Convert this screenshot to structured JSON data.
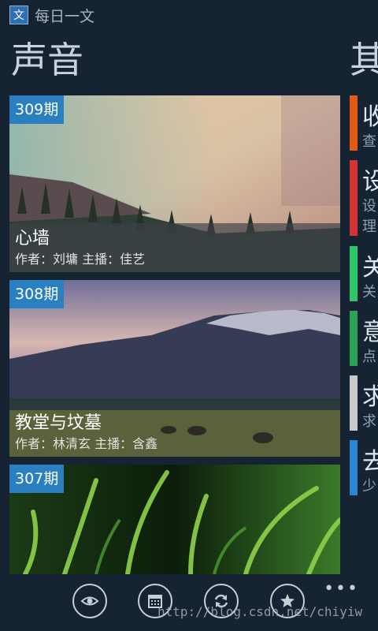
{
  "app": {
    "icon_glyph": "文",
    "title": "每日一文"
  },
  "sections": {
    "left_title": "声音",
    "right_title": "其"
  },
  "cards": [
    {
      "badge": "309期",
      "title": "心墙",
      "meta": "作者：刘墉  主播：佳艺"
    },
    {
      "badge": "308期",
      "title": "教堂与坟墓",
      "meta": "作者：林清玄  主播：含鑫"
    },
    {
      "badge": "307期"
    }
  ],
  "tiles": [
    {
      "color": "#e35a12",
      "big": "收",
      "small": [
        "查"
      ]
    },
    {
      "color": "#d33335",
      "big": "设",
      "small": [
        "设",
        "理"
      ]
    },
    {
      "color": "#2fc56b",
      "big": "关",
      "small": [
        "关"
      ]
    },
    {
      "color": "#2aa358",
      "big": "意",
      "small": [
        "点"
      ]
    },
    {
      "color": "#c9c9c9",
      "big": "求",
      "small": [
        "求"
      ]
    },
    {
      "color": "#2a86d2",
      "big": "去",
      "small": [
        "少"
      ]
    }
  ],
  "appbar": {
    "more": "•••"
  },
  "icons": [
    "eye-icon",
    "calendar-icon",
    "refresh-icon",
    "star-icon"
  ],
  "watermark": "http://blog.csdn.net/chiyiw"
}
